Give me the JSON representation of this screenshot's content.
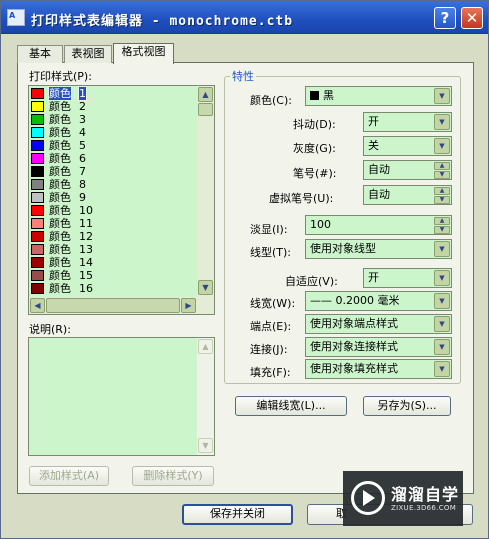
{
  "window": {
    "title": "打印样式表编辑器 - monochrome.ctb",
    "help_glyph": "?",
    "close_glyph": "✕"
  },
  "tabs": [
    {
      "label": "基本",
      "active": false
    },
    {
      "label": "表视图",
      "active": false
    },
    {
      "label": "格式视图",
      "active": true
    }
  ],
  "left": {
    "styles_label": "打印样式(P):",
    "description_label": "说明(R):",
    "description_value": "",
    "add_style_label": "添加样式(A)",
    "delete_style_label": "删除样式(Y)",
    "styles": [
      {
        "name": "颜色",
        "num": "1",
        "color": "#ff0000",
        "selected": true
      },
      {
        "name": "颜色",
        "num": "2",
        "color": "#ffff00"
      },
      {
        "name": "颜色",
        "num": "3",
        "color": "#00c000"
      },
      {
        "name": "颜色",
        "num": "4",
        "color": "#00ffff"
      },
      {
        "name": "颜色",
        "num": "5",
        "color": "#0000ff"
      },
      {
        "name": "颜色",
        "num": "6",
        "color": "#ff00ff"
      },
      {
        "name": "颜色",
        "num": "7",
        "color": "#000000"
      },
      {
        "name": "颜色",
        "num": "8",
        "color": "#808080"
      },
      {
        "name": "颜色",
        "num": "9",
        "color": "#c0c0c0"
      },
      {
        "name": "颜色",
        "num": "10",
        "color": "#ff0000"
      },
      {
        "name": "颜色",
        "num": "11",
        "color": "#ff7f7f"
      },
      {
        "name": "颜色",
        "num": "12",
        "color": "#cc0000"
      },
      {
        "name": "颜色",
        "num": "13",
        "color": "#cc6666"
      },
      {
        "name": "颜色",
        "num": "14",
        "color": "#990000"
      },
      {
        "name": "颜色",
        "num": "15",
        "color": "#994c4c"
      },
      {
        "name": "颜色",
        "num": "16",
        "color": "#7f0000"
      }
    ]
  },
  "properties": {
    "group_title": "特性",
    "color": {
      "label": "颜色(C):",
      "value": "黑",
      "swatch": "#000000"
    },
    "dither": {
      "label": "抖动(D):",
      "value": "开"
    },
    "grayscale": {
      "label": "灰度(G):",
      "value": "关"
    },
    "pen": {
      "label": "笔号(#):",
      "value": "自动"
    },
    "virtual_pen": {
      "label": "虚拟笔号(U):",
      "value": "自动"
    },
    "screening": {
      "label": "淡显(I):",
      "value": "100"
    },
    "linetype": {
      "label": "线型(T):",
      "value": "使用对象线型"
    },
    "adaptive": {
      "label": "自适应(V):",
      "value": "开"
    },
    "lineweight": {
      "label": "线宽(W):",
      "value": "—— 0.2000 毫米"
    },
    "line_end": {
      "label": "端点(E):",
      "value": "使用对象端点样式"
    },
    "line_join": {
      "label": "连接(J):",
      "value": "使用对象连接样式"
    },
    "fill": {
      "label": "填充(F):",
      "value": "使用对象填充样式"
    },
    "edit_lineweights_label": "编辑线宽(L)...",
    "save_as_label": "另存为(S)..."
  },
  "footer": {
    "save_close_label": "保存并关闭",
    "cancel_partial_label": "取"
  },
  "watermark": {
    "title": "溜溜自学",
    "url": "ZIXUE.3D66.COM"
  }
}
